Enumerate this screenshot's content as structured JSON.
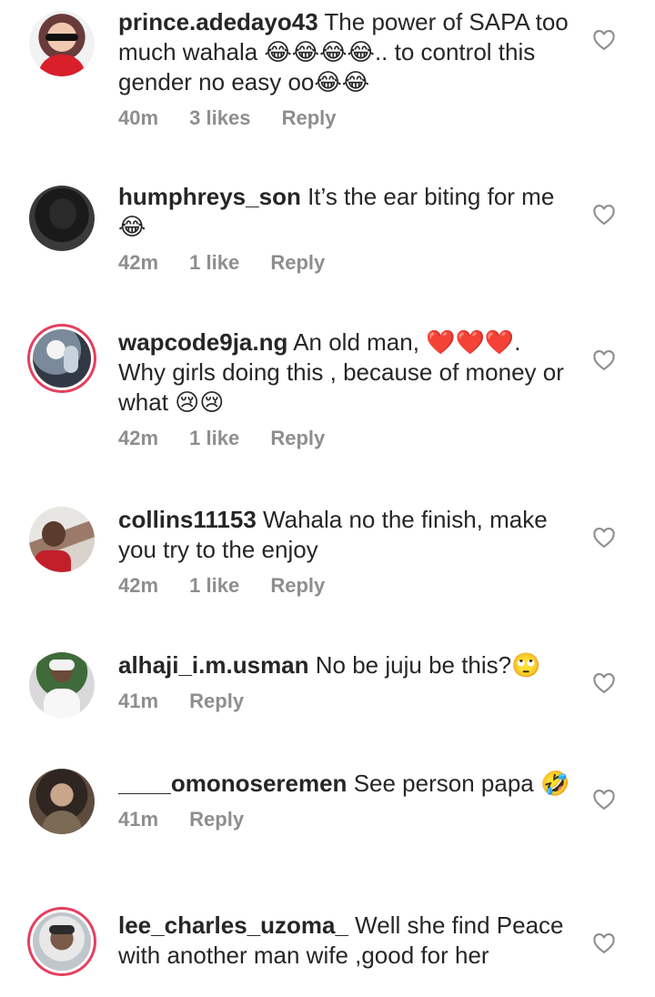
{
  "comments": [
    {
      "username": "prince.adedayo43",
      "text": "The power of SAPA too much  wahala 😂😂😂😂.. to control this gender no easy oo😂😂",
      "time": "40m",
      "likes": "3 likes",
      "reply": "Reply",
      "avatar_ring": false
    },
    {
      "username": "humphreys_son",
      "text": "It’s the ear biting for me😂",
      "time": "42m",
      "likes": "1 like",
      "reply": "Reply",
      "avatar_ring": false
    },
    {
      "username": "wapcode9ja.ng",
      "text": "An old man, ❤️❤️❤️. Why girls doing this , because of money or what 😢😢",
      "time": "42m",
      "likes": "1 like",
      "reply": "Reply",
      "avatar_ring": true
    },
    {
      "username": "collins11153",
      "text": "Wahala no the finish, make you try to the enjoy",
      "time": "42m",
      "likes": "1 like",
      "reply": "Reply",
      "avatar_ring": false
    },
    {
      "username": "alhaji_i.m.usman",
      "text": "No be juju be this?🙄",
      "time": "41m",
      "likes": "",
      "reply": "Reply",
      "avatar_ring": false
    },
    {
      "username": "____omonoseremen",
      "text": "See person papa 🤣",
      "time": "41m",
      "likes": "",
      "reply": "Reply",
      "avatar_ring": false
    },
    {
      "username": "lee_charles_uzoma_",
      "text": "Well she find Peace with another man wife ,good for her",
      "time": "",
      "likes": "",
      "reply": "",
      "avatar_ring": true
    }
  ],
  "colors": {
    "meta": "#8e8e8e",
    "text": "#262626",
    "ring": "#e4405f"
  }
}
